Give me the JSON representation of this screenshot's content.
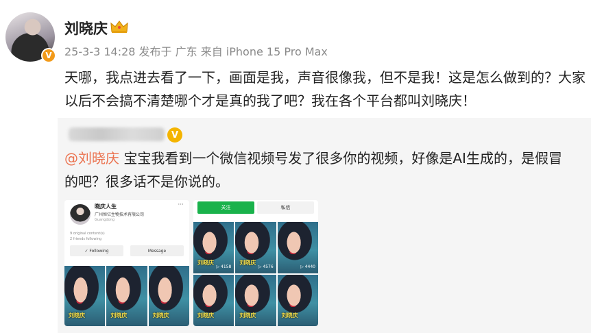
{
  "post": {
    "author": "刘晓庆",
    "verified_mark": "V",
    "meta": "25-3-3 14:28 发布于 广东 来自 iPhone 15 Pro Max",
    "text": "天哪，我点进去看了一下，画面是我，声音很像我，但不是我！这是怎么做到的？大家以后不会搞不清楚哪个才是真的我了吧？我在各个平台都叫刘晓庆！"
  },
  "repost": {
    "gold_mark": "V",
    "mention": "@刘晓庆",
    "text": "宝宝我看到一个微信视频号发了很多你的视频，好像是AI生成的，是假冒的吧？很多话不是你说的。",
    "profile_shot": {
      "name": "晓庆人生",
      "company": "广州恒亿生物技术有限公司",
      "location": "Guangdong",
      "more": "···",
      "original_content": "9 original content(s)",
      "friends_following": "2 friends following",
      "following_label": "✓ Following",
      "message_label": "Message",
      "thumb_caption": "刘晓庆"
    },
    "grid_shot": {
      "tab_follow": "关注",
      "tab_message": "私信",
      "thumbs": [
        {
          "caption": "刘晓庆",
          "count": "▷ 4158"
        },
        {
          "caption": "刘晓庆",
          "count": "▷ 4576"
        },
        {
          "caption": "",
          "count": "▷ 4440"
        },
        {
          "caption": "刘晓庆",
          "count": ""
        },
        {
          "caption": "刘晓庆",
          "count": ""
        },
        {
          "caption": "刘晓庆",
          "count": ""
        }
      ]
    }
  },
  "colors": {
    "mention": "#eb7350",
    "follow_tab": "#19b24b",
    "badge": "#f29a1a"
  }
}
